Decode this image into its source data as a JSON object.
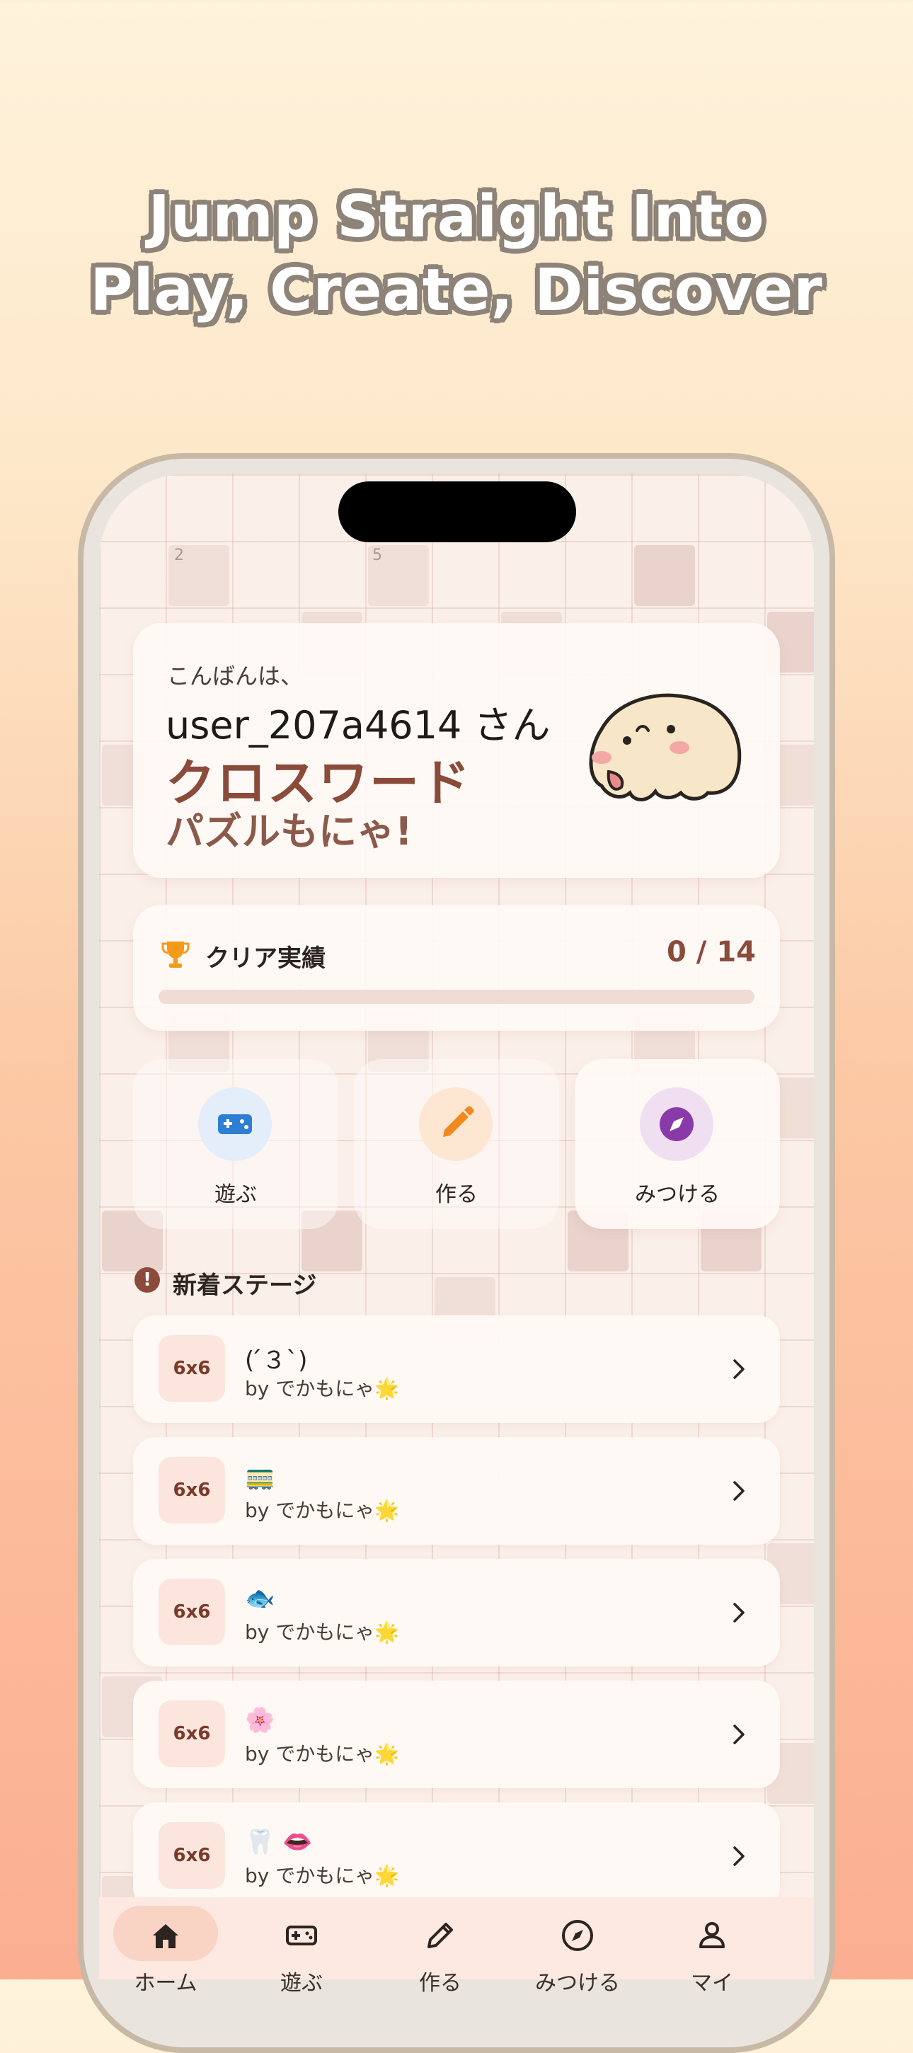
{
  "headline": {
    "line1": "Jump Straight Into",
    "line2": "Play, Create, Discover"
  },
  "greeting": {
    "prefix": "こんばんは、",
    "user": "user_207a4614 さん",
    "title_line1": "クロスワード",
    "title_line2": "パズルもにゃ!"
  },
  "grid_numbers": [
    "2",
    "5"
  ],
  "achievements": {
    "label": "クリア実績",
    "count": "0 / 14",
    "progress": 0.0
  },
  "actions": [
    {
      "label": "遊ぶ",
      "icon": "gamepad-icon",
      "color": "#2d7fd3",
      "bg": "#e3eefa"
    },
    {
      "label": "作る",
      "icon": "pencil-icon",
      "color": "#f08a1c",
      "bg": "#fde6d2"
    },
    {
      "label": "みつける",
      "icon": "compass-icon",
      "color": "#8a3aa8",
      "bg": "#f0dff0"
    }
  ],
  "new_stages": {
    "title": "新着ステージ",
    "items": [
      {
        "size": "6x6",
        "title": "( ́３`)",
        "by": "by でかもにゃ🌟"
      },
      {
        "size": "6x6",
        "title": "🚃",
        "by": "by でかもにゃ🌟"
      },
      {
        "size": "6x6",
        "title": "🐟",
        "by": "by でかもにゃ🌟"
      },
      {
        "size": "6x6",
        "title": "🌸",
        "by": "by でかもにゃ🌟"
      },
      {
        "size": "6x6",
        "title": "🦷 👄",
        "by": "by でかもにゃ🌟"
      }
    ]
  },
  "tabbar": [
    {
      "label": "ホーム",
      "icon": "home-icon",
      "active": true
    },
    {
      "label": "遊ぶ",
      "icon": "gamepad-icon",
      "active": false
    },
    {
      "label": "作る",
      "icon": "pencil-icon",
      "active": false
    },
    {
      "label": "みつける",
      "icon": "compass-icon",
      "active": false
    },
    {
      "label": "マイ",
      "icon": "person-icon",
      "active": false
    }
  ],
  "colors": {
    "accent": "#8b4b3a",
    "background_top": "#fff3dc",
    "background_bottom": "#fbae92"
  }
}
